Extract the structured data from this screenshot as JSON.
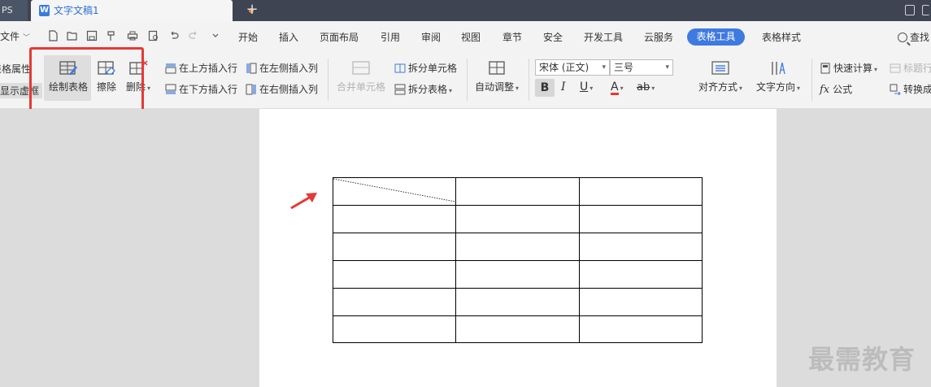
{
  "title_bar": {
    "app_tab": "PS",
    "doc_tab": "文字文稿1",
    "doc_tab_icon": "W",
    "add_tab": "+"
  },
  "menu": {
    "file": "文件",
    "items": [
      "开始",
      "插入",
      "页面布局",
      "引用",
      "审阅",
      "视图",
      "章节",
      "安全",
      "开发工具",
      "云服务",
      "表格工具",
      "表格样式"
    ],
    "active": "表格工具",
    "search": "查找"
  },
  "ribbon": {
    "table_properties": "表格属性",
    "show_gridlines": "显示虚框",
    "draw_table": "绘制表格",
    "erase": "擦除",
    "delete": "删除",
    "insert_row_above": "在上方插入行",
    "insert_row_below": "在下方插入行",
    "insert_col_left": "在左侧插入列",
    "insert_col_right": "在右侧插入列",
    "merge_cells": "合并单元格",
    "split_cells": "拆分单元格",
    "split_table": "拆分表格",
    "auto_fit": "自动调整",
    "font_name": "宋体 (正文)",
    "font_size": "三号",
    "bold": "B",
    "italic": "I",
    "underline": "U",
    "font_color": "A",
    "highlight": "ab",
    "alignment": "对齐方式",
    "text_direction": "文字方向",
    "quick_calc": "快速计算",
    "title_row": "标题行",
    "formula_label": "公式",
    "formula_icon": "fx",
    "convert": "转换成"
  },
  "document": {
    "table": {
      "rows": 6,
      "cols": 3
    },
    "watermark": "最需教育"
  },
  "colors": {
    "accent": "#3f7ae0",
    "highlight_box": "#e53935",
    "annotation_arrow": "#e53935"
  }
}
